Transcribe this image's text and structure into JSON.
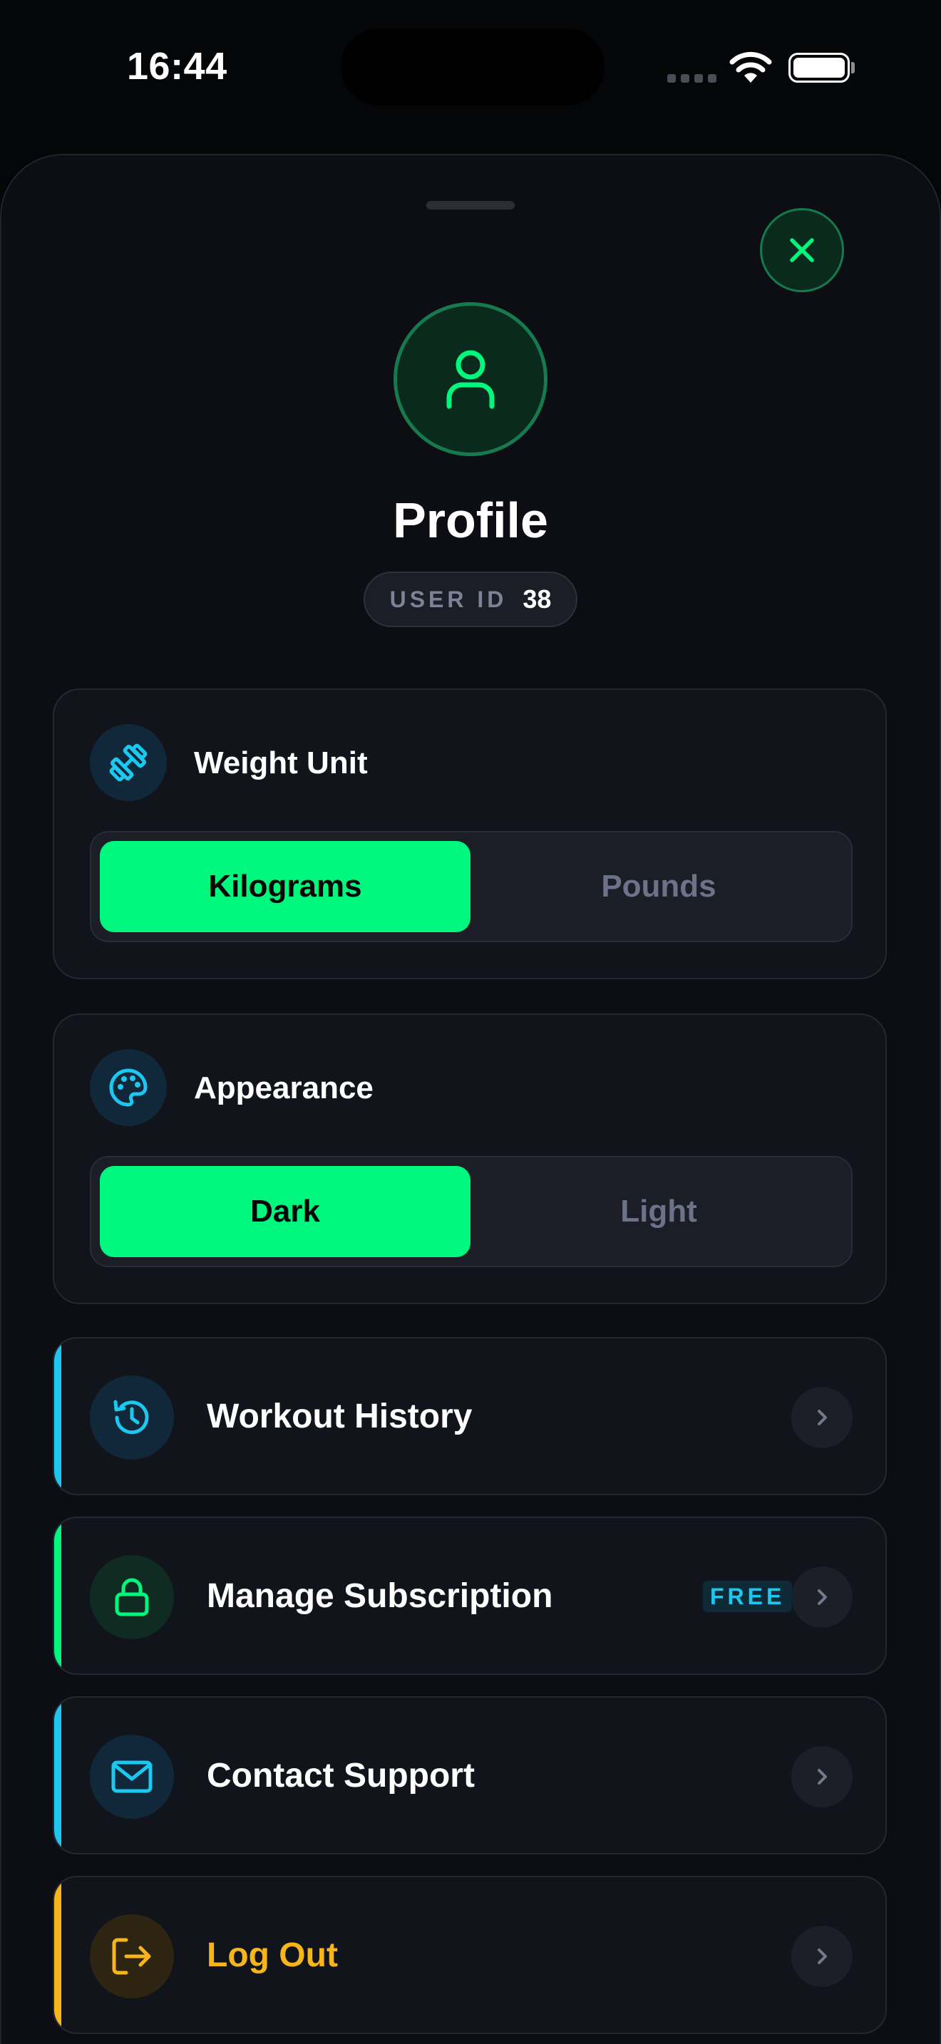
{
  "status_bar": {
    "time": "16:44"
  },
  "header": {
    "title": "Profile",
    "user_id_label": "USER ID",
    "user_id_value": "38"
  },
  "settings": {
    "weight_unit": {
      "title": "Weight Unit",
      "icon": "dumbbell-icon",
      "options": [
        "Kilograms",
        "Pounds"
      ],
      "selected": "Kilograms"
    },
    "appearance": {
      "title": "Appearance",
      "icon": "palette-icon",
      "options": [
        "Dark",
        "Light"
      ],
      "selected": "Dark"
    }
  },
  "menu": [
    {
      "label": "Workout History",
      "icon": "history-icon",
      "accent": "#1cc8f0"
    },
    {
      "label": "Manage Subscription",
      "icon": "lock-icon",
      "accent": "#00f77e",
      "badge": "FREE"
    },
    {
      "label": "Contact Support",
      "icon": "mail-icon",
      "accent": "#1cc8f0"
    },
    {
      "label": "Log Out",
      "icon": "logout-icon",
      "accent": "#f5b51b"
    }
  ],
  "colors": {
    "primary_green": "#00f77e",
    "cyan": "#1cc8f0",
    "amber": "#f5b51b",
    "background": "#050608",
    "card": "#12141b"
  }
}
